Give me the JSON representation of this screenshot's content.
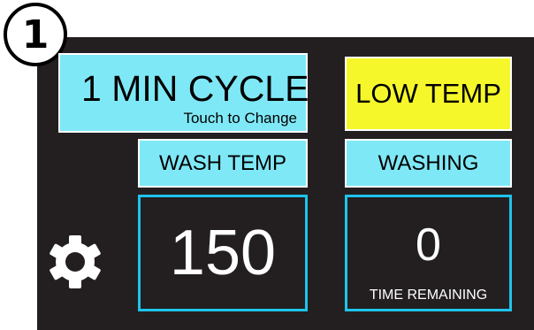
{
  "step_number": "1",
  "cycle_button": {
    "label": "1 MIN CYCLE",
    "hint": "Touch to Change"
  },
  "status_indicator": {
    "label": "LOW TEMP"
  },
  "wash_temp": {
    "label": "WASH TEMP",
    "value": "150"
  },
  "washing": {
    "label": "WASHING",
    "time_value": "0",
    "time_caption": "TIME REMAINING"
  },
  "icons": {
    "settings": "gear-icon"
  },
  "colors": {
    "panel": "#231f20",
    "cyan": "#7fe8f6",
    "yellow": "#f6f72a",
    "border_blue": "#1ec3eb"
  }
}
